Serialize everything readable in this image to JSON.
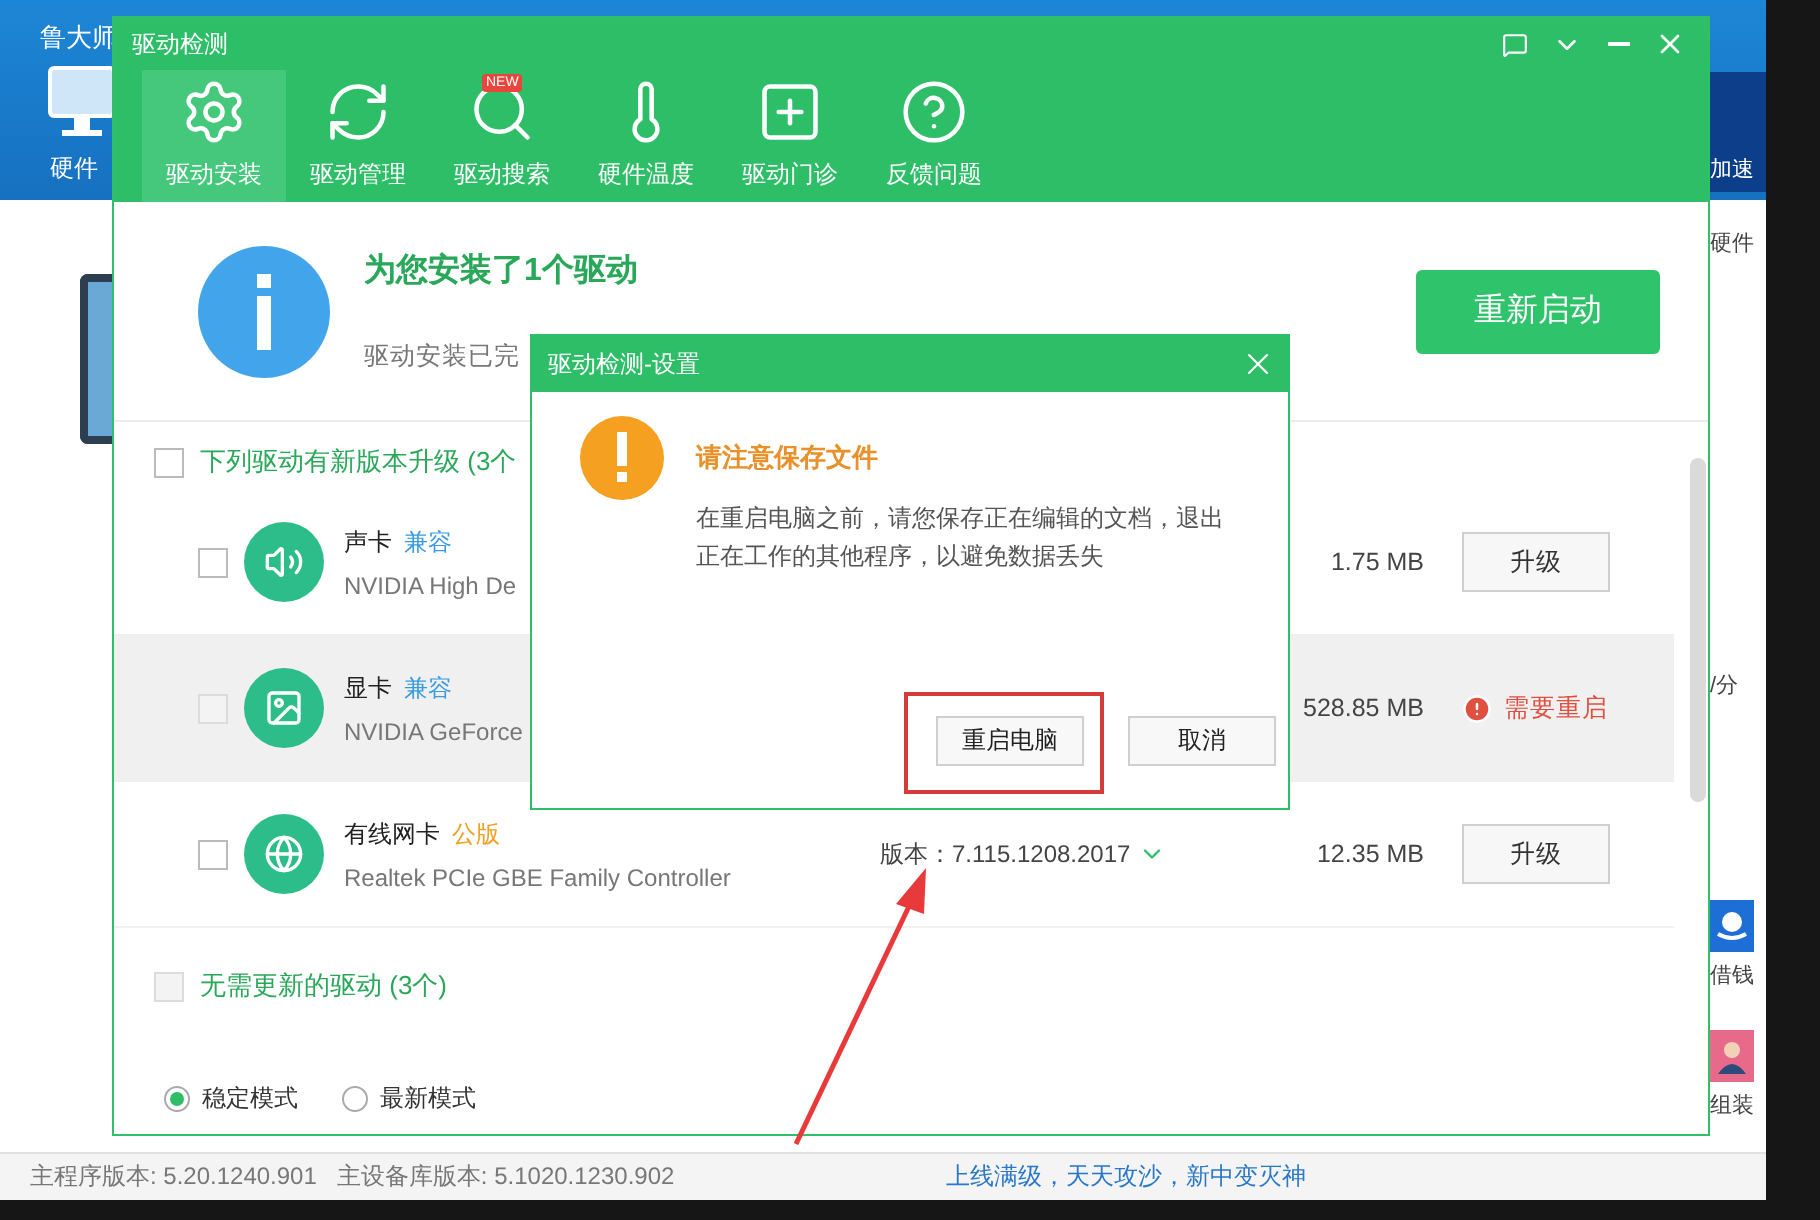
{
  "background_app": {
    "title": "鲁大师",
    "tool_label": "硬件",
    "banner_text": "加速",
    "side_labels": [
      "硬件",
      "/分",
      "借钱",
      "组装"
    ],
    "status_bar": {
      "versions": [
        "主程序版本: 5.20.1240.901",
        "主设备库版本: 5.1020.1230.902"
      ],
      "link": "上线满级，天天攻沙，新中变灭神"
    }
  },
  "window": {
    "title": "驱动检测",
    "tabs": [
      {
        "label": "驱动安装",
        "kind": "gear",
        "selected": true
      },
      {
        "label": "驱动管理",
        "kind": "refresh",
        "selected": false
      },
      {
        "label": "驱动搜索",
        "kind": "search",
        "badge": "NEW",
        "selected": false
      },
      {
        "label": "硬件温度",
        "kind": "thermometer",
        "selected": false
      },
      {
        "label": "驱动门诊",
        "kind": "plus",
        "selected": false
      },
      {
        "label": "反馈问题",
        "kind": "help",
        "selected": false
      }
    ]
  },
  "summary": {
    "title": "为您安装了1个驱动",
    "subtitle": "驱动安装已完",
    "restart_button": "重新启动"
  },
  "sections": [
    {
      "title": "下列驱动有新版本升级 (3个",
      "checked": false,
      "disabled": false,
      "drivers": [
        {
          "kind": "speaker",
          "name": "声卡",
          "tag": {
            "text": "兼容",
            "color": "#3a9be0"
          },
          "description": "NVIDIA High De",
          "size": "1.75 MB",
          "action": {
            "kind": "button",
            "label": "升级"
          },
          "checked": false,
          "disabled": false,
          "highlighted": false
        },
        {
          "kind": "image",
          "name": "显卡",
          "tag": {
            "text": "兼容",
            "color": "#3a9be0"
          },
          "description": "NVIDIA GeForce",
          "size": "528.85 MB",
          "action": {
            "kind": "status",
            "label": "需要重启"
          },
          "checked": false,
          "disabled": true,
          "highlighted": true
        },
        {
          "kind": "globe",
          "name": "有线网卡",
          "tag": {
            "text": "公版",
            "color": "#f0a020"
          },
          "description": "Realtek PCIe GBE Family Controller",
          "version": "版本：7.115.1208.2017",
          "size": "12.35 MB",
          "action": {
            "kind": "button",
            "label": "升级"
          },
          "checked": false,
          "disabled": false,
          "highlighted": false
        }
      ]
    },
    {
      "title": "无需更新的驱动 (3个)",
      "checked": false,
      "disabled": true
    }
  ],
  "modes": [
    {
      "label": "稳定模式",
      "selected": true
    },
    {
      "label": "最新模式",
      "selected": false
    }
  ],
  "dialog": {
    "title": "驱动检测-设置",
    "heading": "请注意保存文件",
    "message": "在重启电脑之前，请您保存正在编辑的文档，退出正在工作的其他程序，以避免数据丢失",
    "buttons": [
      {
        "label": "重启电脑",
        "highlighted": true
      },
      {
        "label": "取消",
        "highlighted": false
      }
    ]
  }
}
